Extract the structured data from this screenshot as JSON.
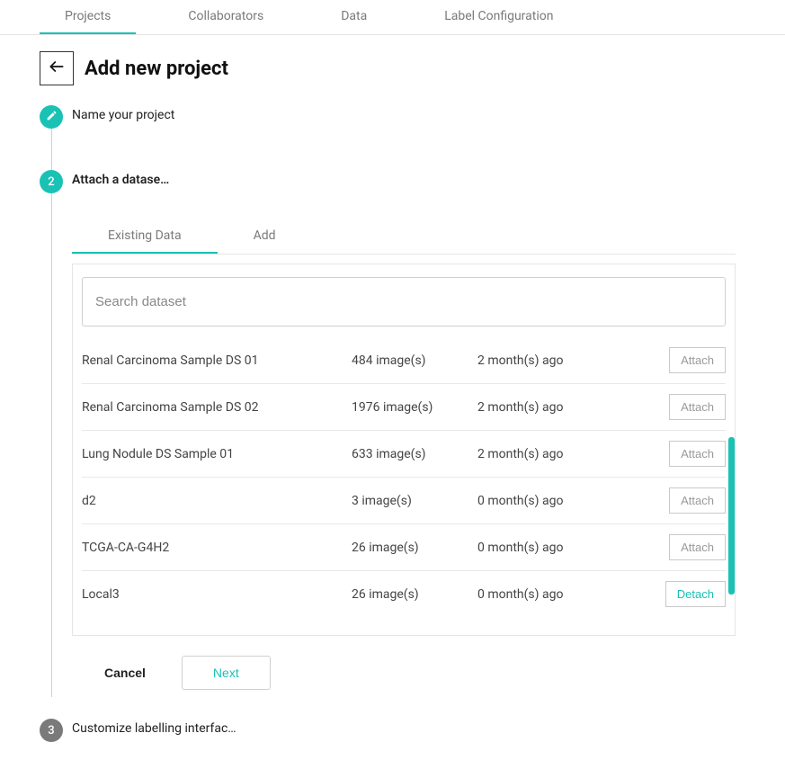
{
  "colors": {
    "accent": "#19c2b5",
    "muted": "#7a7a7a"
  },
  "topTabs": {
    "items": [
      {
        "label": "Projects",
        "active": true
      },
      {
        "label": "Collaborators",
        "active": false
      },
      {
        "label": "Data",
        "active": false
      },
      {
        "label": "Label Configuration",
        "active": false
      }
    ]
  },
  "header": {
    "title": "Add new project"
  },
  "steps": {
    "s1": {
      "label": "Name your project",
      "icon": "edit"
    },
    "s2": {
      "label": "Attach a datase…",
      "number": "2"
    },
    "s3": {
      "label": "Customize labelling interfac…",
      "number": "3"
    }
  },
  "subTabs": {
    "items": [
      {
        "label": "Existing Data",
        "active": true
      },
      {
        "label": "Add",
        "active": false
      }
    ]
  },
  "search": {
    "placeholder": "Search dataset",
    "value": ""
  },
  "datasets": [
    {
      "name": "Renal Carcinoma Sample DS 01",
      "images": "484 image(s)",
      "age": "2 month(s) ago",
      "action": "Attach"
    },
    {
      "name": "Renal Carcinoma Sample DS 02",
      "images": "1976 image(s)",
      "age": "2 month(s) ago",
      "action": "Attach"
    },
    {
      "name": "Lung Nodule DS Sample 01",
      "images": "633 image(s)",
      "age": "2 month(s) ago",
      "action": "Attach"
    },
    {
      "name": "d2",
      "images": "3 image(s)",
      "age": "0 month(s) ago",
      "action": "Attach"
    },
    {
      "name": "TCGA-CA-G4H2",
      "images": "26 image(s)",
      "age": "0 month(s) ago",
      "action": "Attach"
    },
    {
      "name": "Local3",
      "images": "26 image(s)",
      "age": "0 month(s) ago",
      "action": "Detach"
    }
  ],
  "actions": {
    "cancel": "Cancel",
    "next": "Next"
  }
}
